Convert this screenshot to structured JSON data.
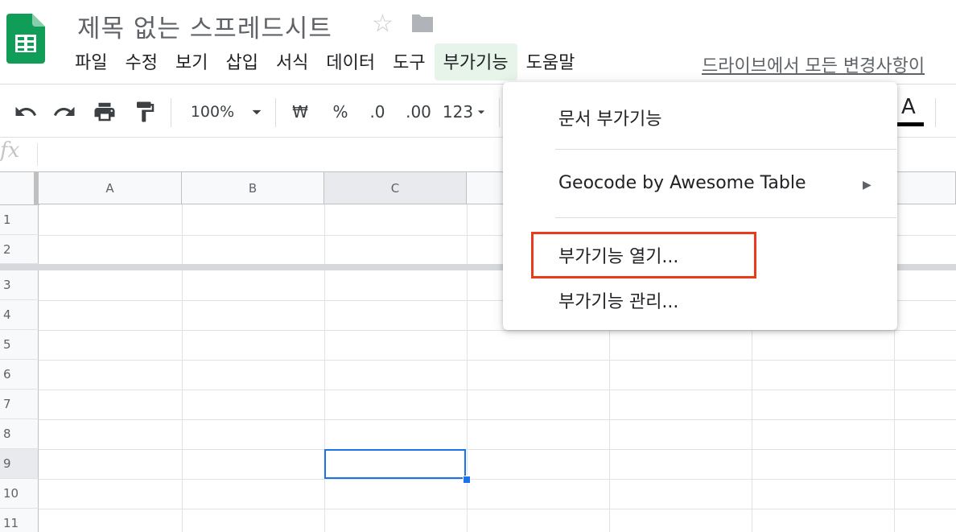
{
  "header": {
    "title": "제목 없는 스프레드시트",
    "last_edit": "드라이브에서 모든 변경사항이"
  },
  "menu": [
    {
      "label": "파일",
      "active": false
    },
    {
      "label": "수정",
      "active": false
    },
    {
      "label": "보기",
      "active": false
    },
    {
      "label": "삽입",
      "active": false
    },
    {
      "label": "서식",
      "active": false
    },
    {
      "label": "데이터",
      "active": false
    },
    {
      "label": "도구",
      "active": false
    },
    {
      "label": "부가기능",
      "active": true
    },
    {
      "label": "도움말",
      "active": false
    }
  ],
  "toolbar": {
    "zoom": "100%",
    "currency": "₩",
    "percent": "%",
    "decrease_decimals": ".0",
    "increase_decimals": ".00",
    "more_formats": "123",
    "text_color_letter": "A"
  },
  "formula_bar": {
    "label": "fx",
    "value": ""
  },
  "grid": {
    "columns": [
      "A",
      "B",
      "C"
    ],
    "rows": [
      "1",
      "2",
      "3",
      "4",
      "5",
      "6",
      "7",
      "8",
      "9",
      "10",
      "11"
    ],
    "selected_column": "C",
    "selected_row": "9",
    "frozen_rows": 2
  },
  "dropdown": {
    "items": [
      {
        "label": "문서 부가기능"
      },
      {
        "label": "Geocode by Awesome Table",
        "has_submenu": true
      },
      {
        "label": "부가기능 열기...",
        "highlighted": true
      },
      {
        "label": "부가기능 관리..."
      }
    ]
  },
  "colors": {
    "accent": "#1a73e8",
    "sheets_green": "#0f9d58",
    "highlight_box": "#ea3a1c",
    "active_menu_bg": "#e6f4ea"
  }
}
